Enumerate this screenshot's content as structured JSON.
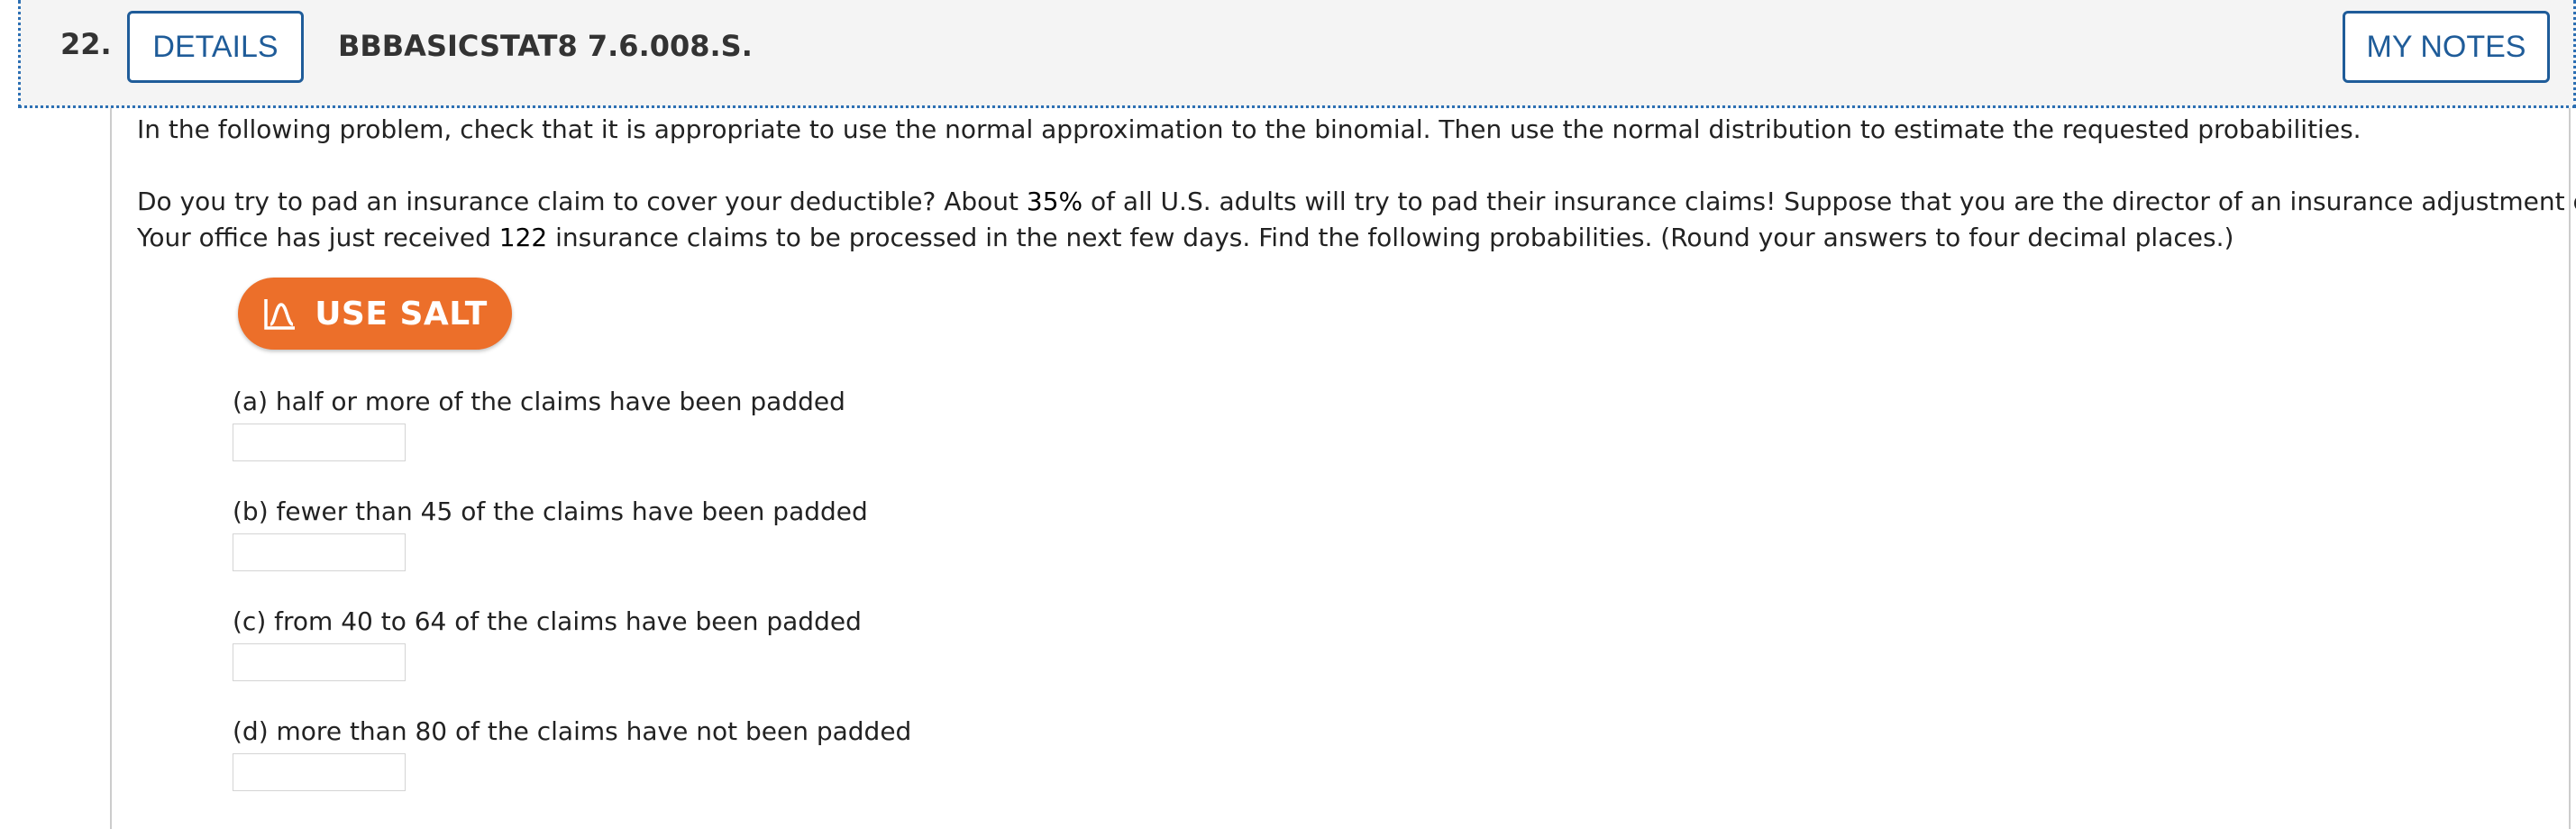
{
  "question": {
    "number": "22.",
    "details_label": "DETAILS",
    "code": "BBBASICSTAT8 7.6.008.S.",
    "my_notes_label": "MY NOTES"
  },
  "content": {
    "instruction": "In the following problem, check that it is appropriate to use the normal approximation to the binomial. Then use the normal distribution to estimate the requested probabilities.",
    "para1_a": "Do you try to pad an insurance claim to cover your deductible? About ",
    "percent": "35%",
    "para1_b": " of all U.S. adults will try to pad their insurance claims! Suppose that you are the director of an insurance adjustment office.",
    "para2_a": "Your office has just received ",
    "claims": "122",
    "para2_b": " insurance claims to be processed in the next few days. Find the following probabilities. (Round your answers to four decimal places.)",
    "salt_label": "USE SALT",
    "parts": [
      {
        "label": "(a) half or more of the claims have been padded",
        "value": "",
        "placeholder": ""
      },
      {
        "label": "(b) fewer than 45 of the claims have been padded",
        "value": "",
        "placeholder": ""
      },
      {
        "label": "(c) from 40 to 64 of the claims have been padded",
        "value": "",
        "placeholder": ""
      },
      {
        "label": "(d) more than 80 of the claims have not been padded",
        "value": "",
        "placeholder": ""
      }
    ]
  },
  "colors": {
    "accent_blue": "#1f5c99",
    "salt_orange": "#ec6f2a"
  },
  "icons": {
    "salt_icon": "bell-curve-chart-icon"
  }
}
